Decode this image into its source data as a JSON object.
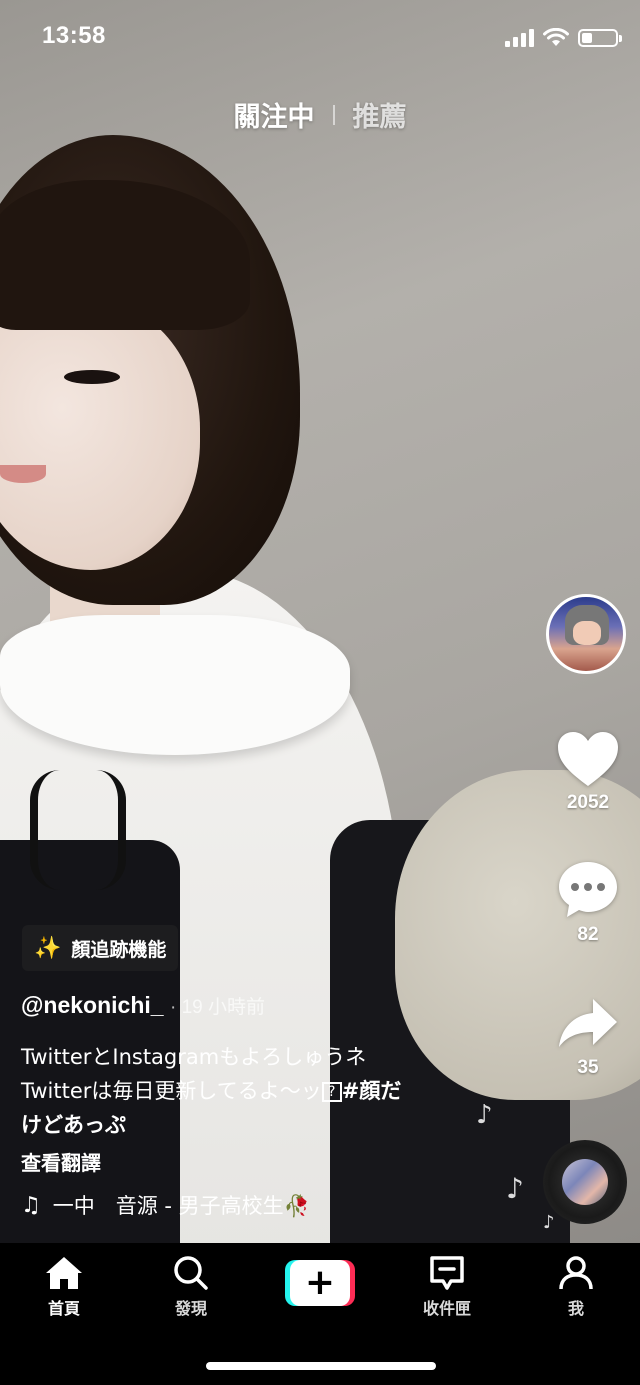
{
  "status_bar": {
    "time": "13:58"
  },
  "top_tabs": {
    "following": "關注中",
    "for_you": "推薦"
  },
  "actions": {
    "likes": "2052",
    "comments": "82",
    "shares": "35"
  },
  "effect": {
    "label": "顏追跡機能"
  },
  "post": {
    "author": "@nekonichi_",
    "time_ago": "· 19 小時前",
    "caption_line1": "TwitterとInstagramもよろしゅうネ",
    "caption_line2": "Twitterは毎日更新してるよ～ッ",
    "hashtag_part1": "#顔だ",
    "hashtag_part2": "けどあっぷ",
    "translate": "查看翻譯",
    "music": "一中　音源 - 男子高校生🥀"
  },
  "nav": {
    "home": "首頁",
    "discover": "發現",
    "inbox": "收件匣",
    "me": "我"
  },
  "colors": {
    "create_cyan": "#25f4ee",
    "create_red": "#fe2c55"
  }
}
